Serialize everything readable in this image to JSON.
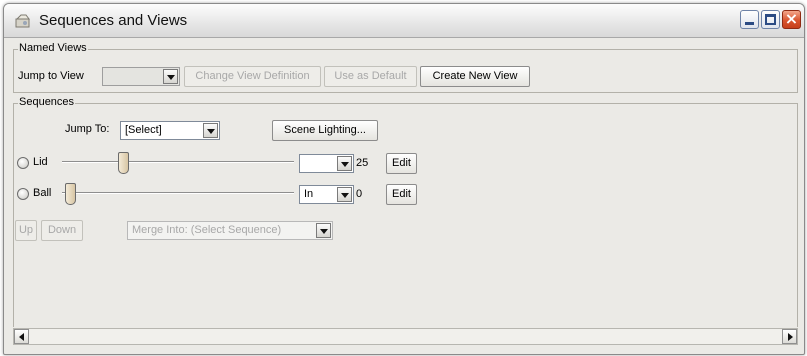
{
  "window": {
    "title": "Sequences and Views",
    "close_glyph": "×"
  },
  "named_views": {
    "legend": "Named Views",
    "jump_to_view_label": "Jump to View",
    "jump_to_view_value": "",
    "change_view_definition": "Change View Definition",
    "use_as_default": "Use as Default",
    "create_new_view": "Create New View"
  },
  "sequences": {
    "legend": "Sequences",
    "jump_to_label": "Jump To:",
    "jump_to_value": "[Select]",
    "scene_lighting": "Scene Lighting...",
    "rows": [
      {
        "name": "Lid",
        "slider_fraction": 0.25,
        "combo_value": "",
        "number": "25",
        "edit": "Edit"
      },
      {
        "name": "Ball",
        "slider_fraction": 0.0,
        "combo_value": "In",
        "number": "0",
        "edit": "Edit"
      }
    ],
    "up": "Up",
    "down": "Down",
    "merge_into": "Merge Into: (Select Sequence)"
  },
  "colors": {
    "close_button": "#d9552f",
    "panel_bg": "#ebeae6",
    "disabled_text": "#a8a8a8"
  }
}
